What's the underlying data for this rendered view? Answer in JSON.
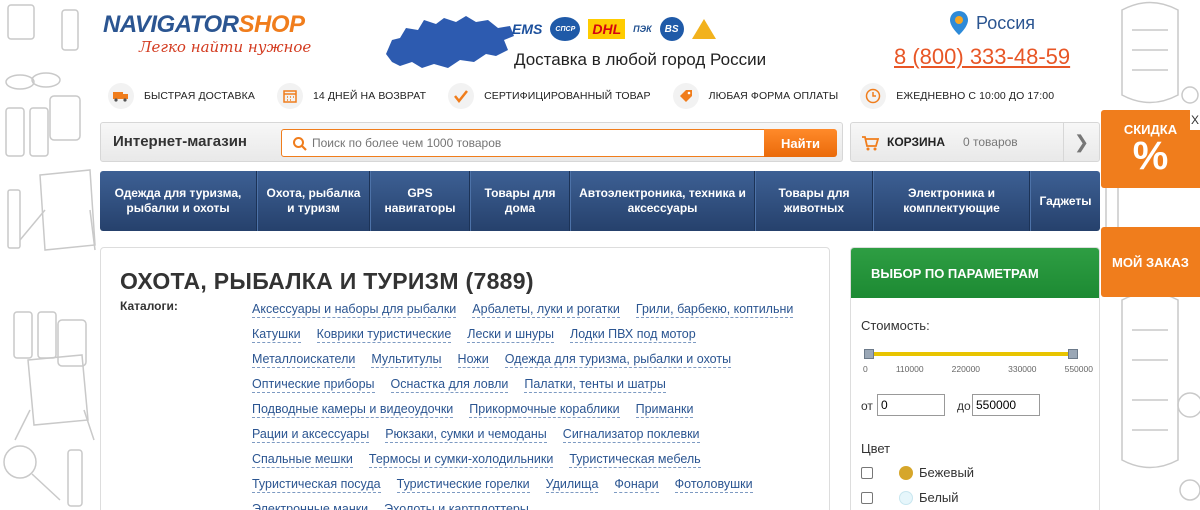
{
  "header": {
    "logo_main_part1": "NAVIGATOR",
    "logo_main_part2": "SHOP",
    "logo_tagline": "Легко найти нужное",
    "carriers": [
      "EMS",
      "СПСР",
      "DHL",
      "ПЭК",
      "BS"
    ],
    "delivery_text": "Доставка в любой город России",
    "region": "Россия",
    "phone": "8 (800) 333-48-59"
  },
  "benefits": [
    {
      "label": "Быстрая доставка",
      "icon": "truck-icon"
    },
    {
      "label": "14 дней на возврат",
      "icon": "calendar-icon"
    },
    {
      "label": "Сертифицированный товар",
      "icon": "checkmark-icon"
    },
    {
      "label": "Любая форма оплаты",
      "icon": "tag-icon"
    },
    {
      "label": "Ежедневно с 10:00 до 17:00",
      "icon": "clock-icon"
    }
  ],
  "search": {
    "shop_label": "Интернет-магазин",
    "placeholder": "Поиск по более чем 1000 товаров",
    "button": "Найти"
  },
  "cart": {
    "label": "КОРЗИНА",
    "count": "0 товаров"
  },
  "nav": [
    "Одежда для туризма, рыбалки и охоты",
    "Охота, рыбалка и туризм",
    "GPS навигаторы",
    "Товары для дома",
    "Автоэлектроника, техника и аксессуары",
    "Товары для животных",
    "Электроника и комплектующие",
    "Гаджеты"
  ],
  "promo": {
    "label": "СКИДКА",
    "percent": "%",
    "close": "X",
    "order": "МОЙ ЗАКАЗ"
  },
  "main": {
    "title": "ОХОТА, РЫБАЛКА И ТУРИЗМ (7889)",
    "catalog_label": "Каталоги:",
    "categories": [
      "Аксессуары и наборы для рыбалки",
      "Арбалеты, луки и рогатки",
      "Грили, барбекю, коптильни",
      "Катушки",
      "Коврики туристические",
      "Лески и шнуры",
      "Лодки ПВХ под мотор",
      "Металлоискатели",
      "Мультитулы",
      "Ножи",
      "Одежда для туризма, рыбалки и охоты",
      "Оптические приборы",
      "Оснастка для ловли",
      "Палатки, тенты и шатры",
      "Подводные камеры и видеоудочки",
      "Прикормочные кораблики",
      "Приманки",
      "Рации и аксессуары",
      "Рюкзаки, сумки и чемоданы",
      "Сигнализатор поклевки",
      "Спальные мешки",
      "Термосы и сумки-холодильники",
      "Туристическая мебель",
      "Туристическая посуда",
      "Туристические горелки",
      "Удилища",
      "Фонари",
      "Фотоловушки",
      "Электронные манки",
      "Эхолоты и картплоттеры"
    ]
  },
  "filter": {
    "title": "ВЫБОР ПО ПАРАМЕТРАМ",
    "price_label": "Стоимость:",
    "ticks": [
      "0",
      "110000",
      "220000",
      "330000",
      "550000"
    ],
    "from_label": "от",
    "from_value": "0",
    "to_label": "до",
    "to_value": "550000",
    "color_label": "Цвет",
    "colors": [
      {
        "name": "Бежевый",
        "hex": "#d6a62a"
      },
      {
        "name": "Белый",
        "hex": "#e6f6fb"
      }
    ]
  }
}
